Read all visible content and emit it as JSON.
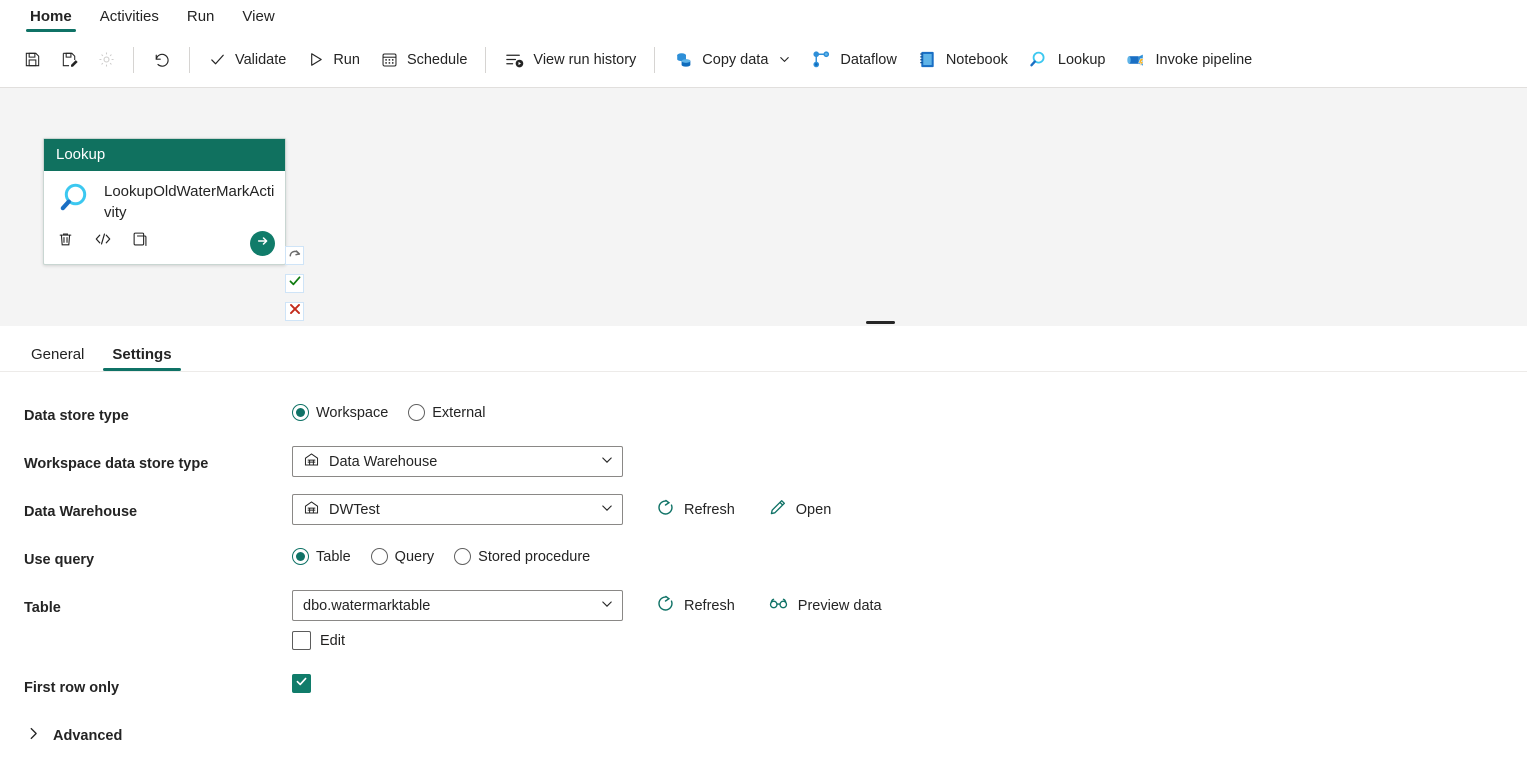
{
  "ribbon": {
    "tabs": [
      {
        "label": "Home",
        "active": true
      },
      {
        "label": "Activities",
        "active": false
      },
      {
        "label": "Run",
        "active": false
      },
      {
        "label": "View",
        "active": false
      }
    ]
  },
  "toolbar": {
    "save_label": "Save",
    "save_as_label": "Save as",
    "settings_label": "Settings",
    "undo_label": "Undo",
    "validate_label": "Validate",
    "run_label": "Run",
    "schedule_label": "Schedule",
    "view_run_history_label": "View run history",
    "copy_data_label": "Copy data",
    "dataflow_label": "Dataflow",
    "notebook_label": "Notebook",
    "lookup_label": "Lookup",
    "invoke_pipeline_label": "Invoke pipeline"
  },
  "canvas": {
    "activity": {
      "type_label": "Lookup",
      "name": "LookupOldWaterMarkActivity",
      "icon": "lookup-magnifier-icon",
      "actions": [
        {
          "name": "delete-activity",
          "icon": "trash-icon"
        },
        {
          "name": "view-code",
          "icon": "code-icon"
        },
        {
          "name": "duplicate-activity",
          "icon": "copy-icon"
        }
      ],
      "run_button": "run-activity-arrow-icon"
    },
    "connectors": [
      {
        "name": "on-skip",
        "icon": "skip-arrow-icon",
        "color": "#6b6b6b"
      },
      {
        "name": "on-success",
        "icon": "check-icon",
        "color": "#107c10"
      },
      {
        "name": "on-failure",
        "icon": "cross-icon",
        "color": "#c42b1c"
      },
      {
        "name": "on-completion",
        "icon": "arrow-right-icon",
        "color": "#0f6cbd"
      }
    ]
  },
  "panel": {
    "tabs": [
      {
        "label": "General",
        "active": false
      },
      {
        "label": "Settings",
        "active": true
      }
    ],
    "fields": {
      "data_store_type": {
        "label": "Data store type",
        "options": [
          {
            "label": "Workspace",
            "selected": true
          },
          {
            "label": "External",
            "selected": false
          }
        ]
      },
      "workspace_data_store_type": {
        "label": "Workspace data store type",
        "value": "Data Warehouse",
        "icon": "warehouse-icon"
      },
      "data_warehouse": {
        "label": "Data Warehouse",
        "value": "DWTest",
        "icon": "warehouse-icon",
        "refresh_label": "Refresh",
        "open_label": "Open"
      },
      "use_query": {
        "label": "Use query",
        "options": [
          {
            "label": "Table",
            "selected": true
          },
          {
            "label": "Query",
            "selected": false
          },
          {
            "label": "Stored procedure",
            "selected": false
          }
        ]
      },
      "table": {
        "label": "Table",
        "value": "dbo.watermarktable",
        "refresh_label": "Refresh",
        "preview_label": "Preview data",
        "edit_label": "Edit",
        "edit_checked": false
      },
      "first_row_only": {
        "label": "First row only",
        "checked": true
      },
      "advanced": {
        "label": "Advanced",
        "expanded": false
      }
    }
  },
  "colors": {
    "accent_teal": "#0f7266",
    "activity_header": "#10715f",
    "checkbox_checked": "#107c6a",
    "success_green": "#107c10",
    "error_red": "#c42b1c",
    "link_blue": "#0f6cbd"
  }
}
